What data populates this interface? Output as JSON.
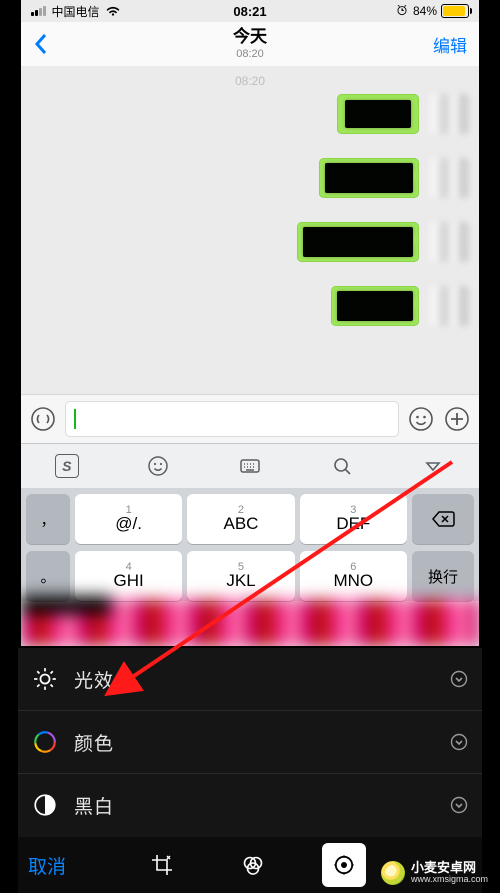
{
  "status": {
    "carrier": "中国电信",
    "time": "08:21",
    "battery_pct": "84%",
    "battery_fill_pct": 84
  },
  "nav": {
    "title": "今天",
    "subtitle": "08:20",
    "edit": "编辑"
  },
  "chat": {
    "time_label": "08:20"
  },
  "keyboard": {
    "keys": {
      "k1_num": "1",
      "k1": "@/.",
      "k2_num": "2",
      "k2": "ABC",
      "k3_num": "3",
      "k3": "DEF",
      "k4_num": "4",
      "k4": "GHI",
      "k5_num": "5",
      "k5": "JKL",
      "k6_num": "6",
      "k6": "MNO",
      "return": "换行",
      "side_comma": "，",
      "side_period": "。"
    }
  },
  "editor": {
    "light": "光效",
    "color": "颜色",
    "bw": "黑白"
  },
  "toolbar": {
    "cancel": "取消"
  },
  "watermark": {
    "name": "小麦安卓网",
    "url": "www.xmsigma.com"
  }
}
